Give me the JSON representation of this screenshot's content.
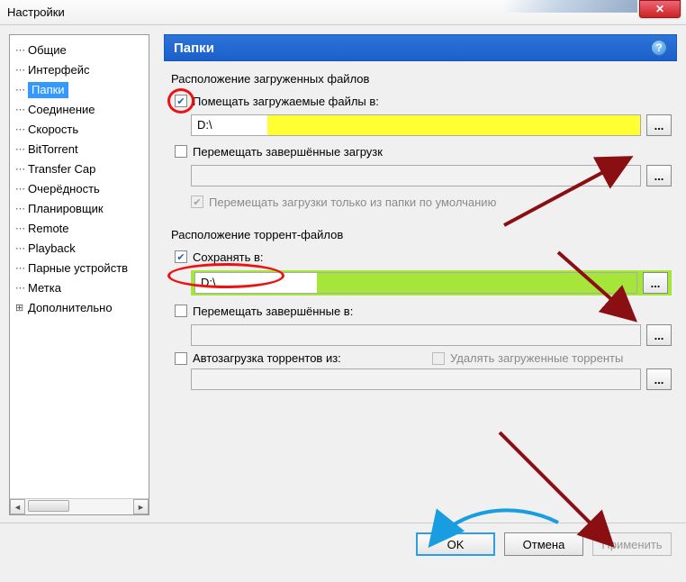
{
  "window": {
    "title": "Настройки",
    "close_glyph": "✕"
  },
  "sidebar": {
    "items": [
      {
        "label": "Общие"
      },
      {
        "label": "Интерфейс"
      },
      {
        "label": "Папки",
        "selected": true
      },
      {
        "label": "Соединение"
      },
      {
        "label": "Скорость"
      },
      {
        "label": "BitTorrent"
      },
      {
        "label": "Transfer Cap"
      },
      {
        "label": "Очерёдность"
      },
      {
        "label": "Планировщик"
      },
      {
        "label": "Remote"
      },
      {
        "label": "Playback"
      },
      {
        "label": "Парные устройств"
      },
      {
        "label": "Метка"
      },
      {
        "label": "Дополнительно",
        "expander": "⊞"
      }
    ],
    "scroll_l": "◄",
    "scroll_r": "►"
  },
  "panel": {
    "title": "Папки",
    "help_glyph": "?",
    "group1_title": "Расположение загруженных файлов",
    "put_downloads_label": "Помещать загружаемые файлы в:",
    "put_downloads_checked": "✔",
    "put_downloads_path": "D:\\",
    "move_completed_label": "Перемещать завершённые загрузк",
    "move_from_default_label": "Перемещать загрузки только из папки по умолчанию",
    "move_from_default_checked": "✔",
    "group2_title": "Расположение торрент-файлов",
    "save_in_label": "Сохранять в:",
    "save_in_checked": "✔",
    "save_in_path": "D:\\",
    "move_completed_to_label": "Перемещать завершённые в:",
    "autoload_label": "Автозагрузка торрентов из:",
    "delete_loaded_label": "Удалять загруженные торренты",
    "browse_glyph": "..."
  },
  "footer": {
    "ok": "OK",
    "cancel": "Отмена",
    "apply": "Применить"
  }
}
